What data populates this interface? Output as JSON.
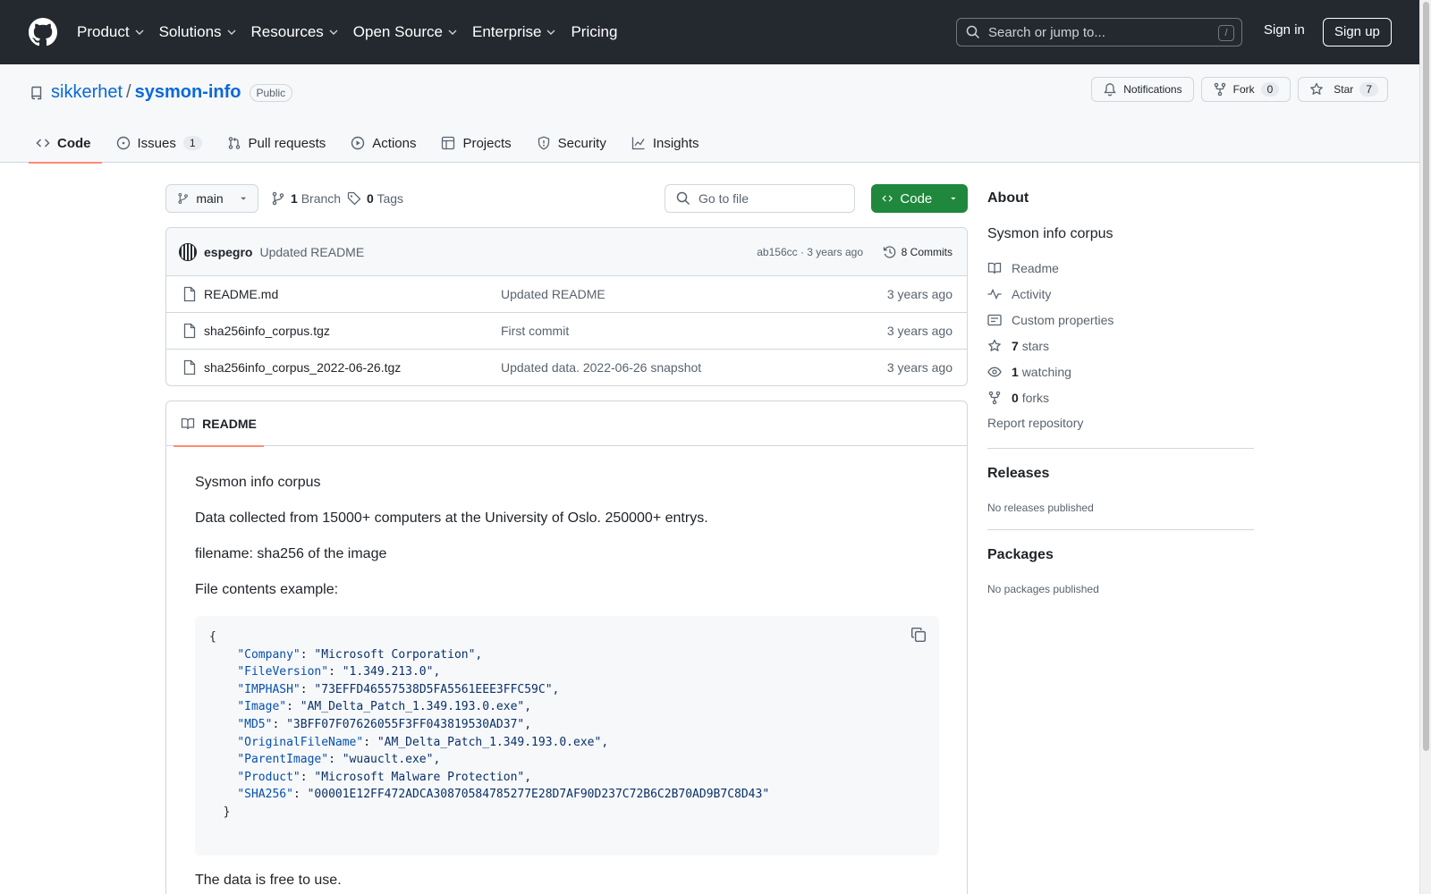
{
  "header": {
    "nav": [
      "Product",
      "Solutions",
      "Resources",
      "Open Source",
      "Enterprise",
      "Pricing"
    ],
    "search_placeholder": "Search or jump to...",
    "search_shortcut": "/",
    "signin": "Sign in",
    "signup": "Sign up"
  },
  "repo": {
    "owner": "sikkerhet",
    "separator": "/",
    "name": "sysmon-info",
    "visibility": "Public",
    "notifications": "Notifications",
    "fork_label": "Fork",
    "fork_count": "0",
    "star_label": "Star",
    "star_count": "7"
  },
  "tabs": [
    {
      "label": "Code",
      "icon": "code-icon",
      "active": true
    },
    {
      "label": "Issues",
      "icon": "issue-icon",
      "count": "1"
    },
    {
      "label": "Pull requests",
      "icon": "pull-request-icon"
    },
    {
      "label": "Actions",
      "icon": "play-icon"
    },
    {
      "label": "Projects",
      "icon": "table-icon"
    },
    {
      "label": "Security",
      "icon": "shield-icon"
    },
    {
      "label": "Insights",
      "icon": "graph-icon"
    }
  ],
  "branch": {
    "current": "main",
    "branch_count": "1",
    "branch_label": "Branch",
    "tag_count": "0",
    "tag_label": "Tags",
    "goto_placeholder": "Go to file",
    "code_button": "Code"
  },
  "commit": {
    "author": "espegro",
    "message": "Updated README",
    "hash_time": "ab156cc · 3 years ago",
    "commits_count": "8 Commits"
  },
  "files": [
    {
      "name": "README.md",
      "message": "Updated README",
      "age": "3 years ago"
    },
    {
      "name": "sha256info_corpus.tgz",
      "message": "First commit",
      "age": "3 years ago"
    },
    {
      "name": "sha256info_corpus_2022-06-26.tgz",
      "message": "Updated data. 2022-06-26 snapshot",
      "age": "3 years ago"
    }
  ],
  "readme": {
    "tab_label": "README",
    "paragraphs": [
      "Sysmon info corpus",
      "Data collected from 15000+ computers at the University of Oslo. 250000+ entrys.",
      "filename: sha256 of the image",
      "File contents example:"
    ],
    "code_lines": [
      {
        "indent": "",
        "key": "",
        "value": "{"
      },
      {
        "indent": "    ",
        "key": "\"Company\"",
        "value": "\"Microsoft Corporation\","
      },
      {
        "indent": "    ",
        "key": "\"FileVersion\"",
        "value": "\"1.349.213.0\","
      },
      {
        "indent": "    ",
        "key": "\"IMPHASH\"",
        "value": "\"73EFFD46557538D5FA5561EEE3FFC59C\","
      },
      {
        "indent": "    ",
        "key": "\"Image\"",
        "value": "\"AM_Delta_Patch_1.349.193.0.exe\","
      },
      {
        "indent": "    ",
        "key": "\"MD5\"",
        "value": "\"3BFF07F07626055F3FF043819530AD37\","
      },
      {
        "indent": "    ",
        "key": "\"OriginalFileName\"",
        "value": "\"AM_Delta_Patch_1.349.193.0.exe\","
      },
      {
        "indent": "    ",
        "key": "\"ParentImage\"",
        "value": "\"wuauclt.exe\","
      },
      {
        "indent": "    ",
        "key": "\"Product\"",
        "value": "\"Microsoft Malware Protection\","
      },
      {
        "indent": "    ",
        "key": "\"SHA256\"",
        "value": "\"00001E12FF472ADCA30870584785277E28D7AF90D237C72B6C2B70AD9B7C8D43\""
      },
      {
        "indent": "  ",
        "key": "",
        "value": "}"
      }
    ],
    "footer_text": "The data is free to use."
  },
  "sidebar": {
    "about_title": "About",
    "description": "Sysmon info corpus",
    "items": [
      {
        "icon": "book-icon",
        "label": "Readme"
      },
      {
        "icon": "pulse-icon",
        "label": "Activity"
      },
      {
        "icon": "note-icon",
        "label": "Custom properties"
      },
      {
        "icon": "star-icon",
        "count": "7",
        "label": "stars"
      },
      {
        "icon": "eye-icon",
        "count": "1",
        "label": "watching"
      },
      {
        "icon": "fork-icon",
        "count": "0",
        "label": "forks"
      }
    ],
    "report": "Report repository",
    "releases_title": "Releases",
    "releases_text": "No releases published",
    "packages_title": "Packages",
    "packages_text": "No packages published"
  },
  "colors": {
    "header_bg": "#24292f",
    "link": "#0969da",
    "code_button": "#1f883d",
    "active_tab_underline": "#fd8c73"
  }
}
